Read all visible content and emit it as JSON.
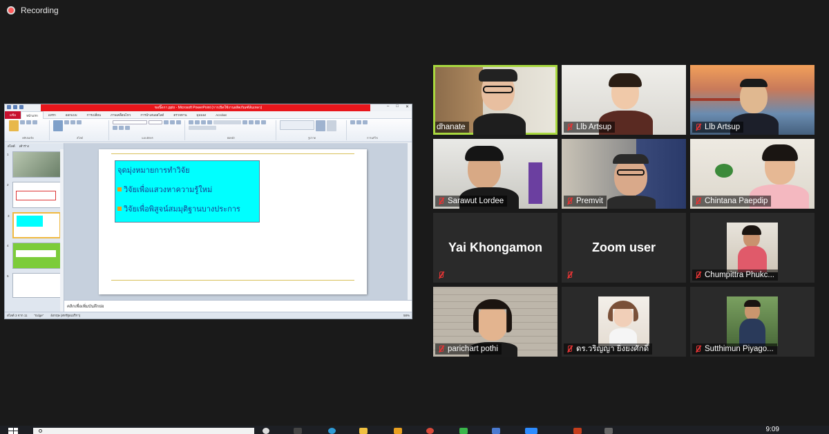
{
  "recording": {
    "label": "Recording"
  },
  "powerpoint": {
    "window_title": "ขอบิ๊ดกา.pptx - Microsoft PowerPoint (การเปิดใช้งานผลิตภัณฑ์ล้มเหลว)",
    "tabs": [
      "แฟ้ม",
      "หน้าแรก",
      "แทรก",
      "ออกแบบ",
      "การเปลี่ยน",
      "ภาพเคลื่อนไหว",
      "การนำเสนอสไลด์",
      "ตรวจทาน",
      "มุมมอง",
      "Acrobat"
    ],
    "ribbon_groups": [
      "คลิปบอร์ด",
      "สไลด์",
      "แบบอักษร",
      "ย่อหน้า",
      "รูปวาด",
      "การแก้ไข"
    ],
    "side_tabs": [
      "สไลด์",
      "เค้าร่าง"
    ],
    "slide_numbers": [
      "1",
      "2",
      "3",
      "4",
      "5"
    ],
    "slide": {
      "title": "จุดมุ่งหมายการทำวิจัย",
      "bullets": [
        "วิจัยเพื่อแสวงหาความรู้ใหม่",
        "วิจัยเพื่อพิสูจน์สมมุติฐานบางประการ"
      ]
    },
    "notes_placeholder": "คลิกเพื่อเพิ่มบันทึกย่อ",
    "status": {
      "slide": "สไลด์ 3 จาก 11",
      "theme": "\"Edge\"",
      "language": "อังกฤษ (สหรัฐอเมริกา)",
      "zoom": "58%"
    }
  },
  "participants": [
    {
      "name": "dhanate",
      "active": true,
      "muted": false,
      "type": "video"
    },
    {
      "name": "Llb Artsup",
      "muted": true,
      "type": "video"
    },
    {
      "name": "Llb Artsup",
      "muted": true,
      "type": "video"
    },
    {
      "name": "Sarawut Lordee",
      "muted": true,
      "type": "video"
    },
    {
      "name": "Premvit",
      "muted": true,
      "type": "video"
    },
    {
      "name": "Chintana Paepdip",
      "muted": true,
      "type": "video"
    },
    {
      "name": "Yai Khongamon",
      "muted": true,
      "type": "name"
    },
    {
      "name": "Zoom user",
      "muted": true,
      "type": "name"
    },
    {
      "name": "Chumpittra Phukc...",
      "muted": true,
      "type": "photo"
    },
    {
      "name": "parichart pothi",
      "muted": true,
      "type": "video"
    },
    {
      "name": "ดร.วริญญา ยิ่งยงศักดิ์",
      "muted": true,
      "type": "photo"
    },
    {
      "name": "Sutthimun Piyago...",
      "muted": true,
      "type": "photo"
    }
  ],
  "taskbar": {
    "time": "9:09"
  }
}
